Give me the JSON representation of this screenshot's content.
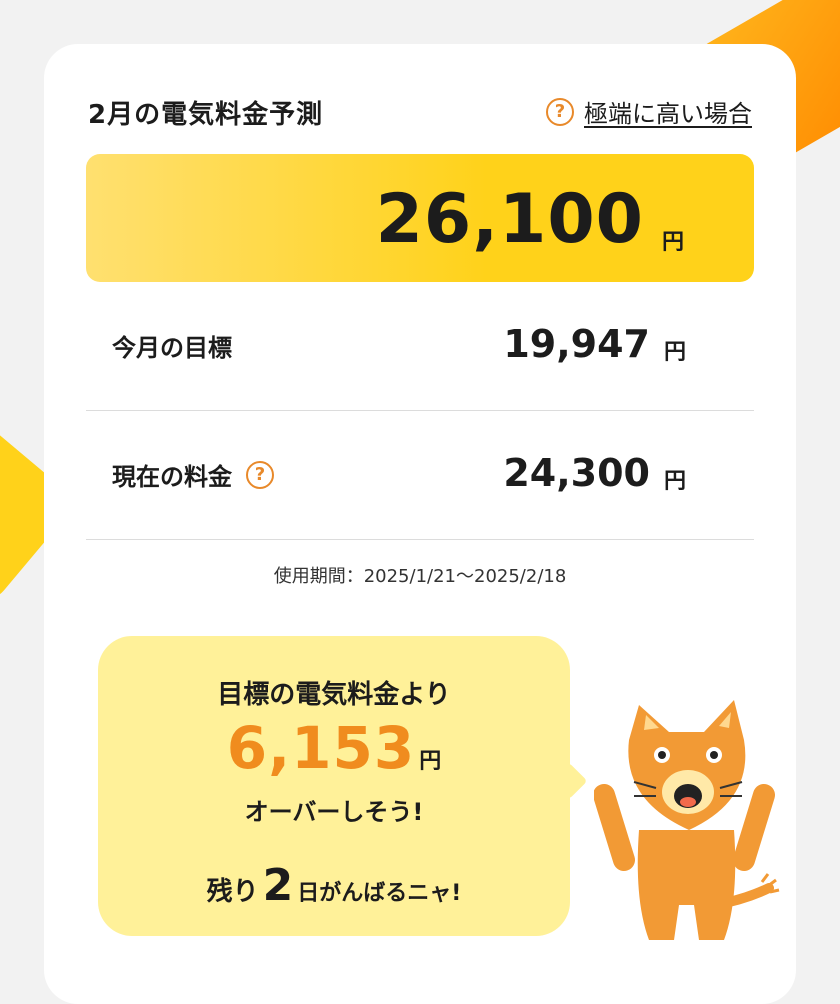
{
  "header": {
    "title": "2月の電気料金予測",
    "help_icon": "question-circle-icon",
    "help_link": "極端に高い場合"
  },
  "forecast": {
    "amount": "26,100",
    "unit": "円"
  },
  "rows": [
    {
      "label": "今月の目標",
      "amount": "19,947",
      "unit": "円",
      "has_help": false
    },
    {
      "label": "現在の料金",
      "amount": "24,300",
      "unit": "円",
      "has_help": true
    }
  ],
  "period": "使用期間：2025/1/21〜2025/2/18",
  "message": {
    "line1": "目標の電気料金より",
    "over_amount": "6,153",
    "over_unit": "円",
    "line2": "オーバーしそう!",
    "line3_prefix": "残り",
    "days": "2",
    "days_unit": "日がんばるニャ!"
  },
  "mascot": "cat-mascot",
  "colors": {
    "accent_orange": "#f08c1e",
    "forecast_yellow": "#ffd21a",
    "bubble_yellow": "#fff199",
    "icon_orange": "#e8892a"
  }
}
